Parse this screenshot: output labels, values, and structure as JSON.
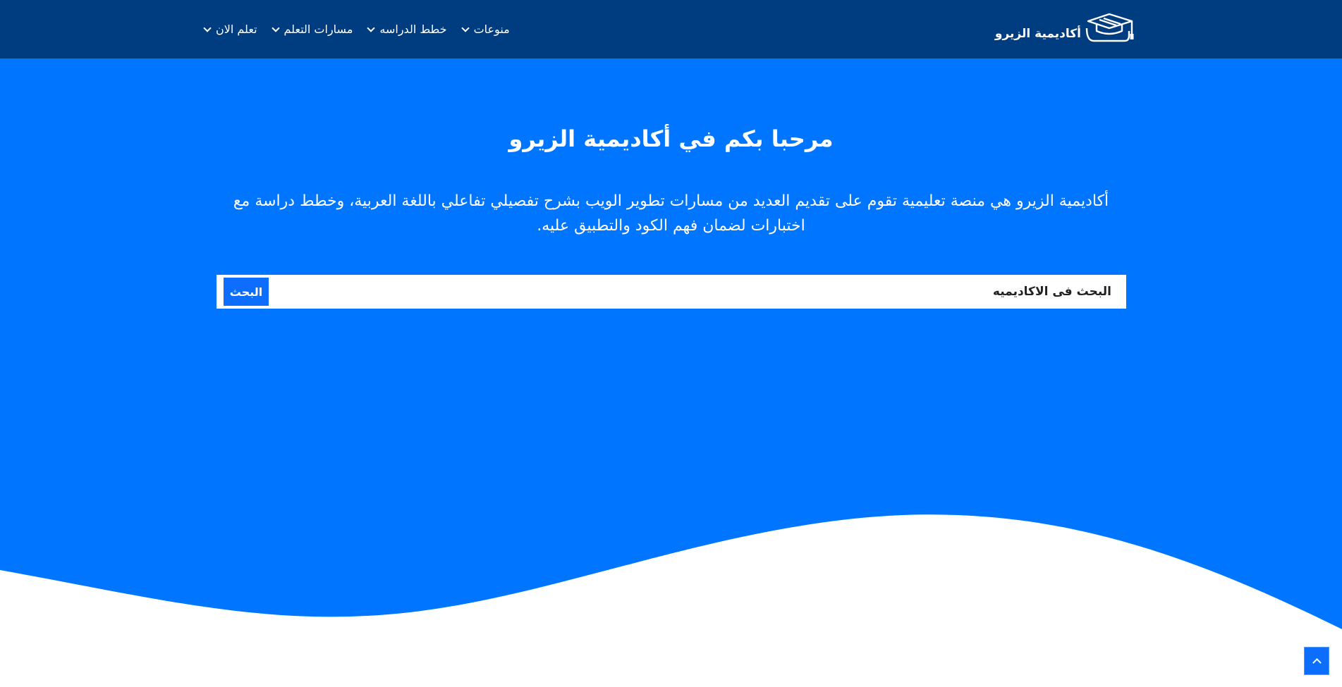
{
  "header": {
    "logo_text": "أكاديمية الزيرو",
    "nav": [
      {
        "label": "تعلم الان"
      },
      {
        "label": "مسارات التعلم"
      },
      {
        "label": "خطط الدراسه"
      },
      {
        "label": "منوعات"
      }
    ]
  },
  "hero": {
    "title": "مرحبا بكم في أكاديمية الزيرو",
    "description": "أكاديمية الزيرو هي منصة تعليمية تقوم على تقديم العديد من مسارات تطوير الويب بشرح تفصيلي تفاعلي باللغة العربية، وخطط دراسة مع اختبارات لضمان فهم الكود والتطبيق عليه.",
    "search": {
      "placeholder": "البحث فى الاكاديميه",
      "button_label": "البحث"
    }
  },
  "colors": {
    "navbar": "#003c80",
    "hero": "#0075ff",
    "button": "#0d6efd"
  },
  "icons": {
    "logo": "graduation-cap-icon",
    "nav_dropdown": "chevron-down-icon",
    "scroll_top": "chevron-up-icon"
  }
}
